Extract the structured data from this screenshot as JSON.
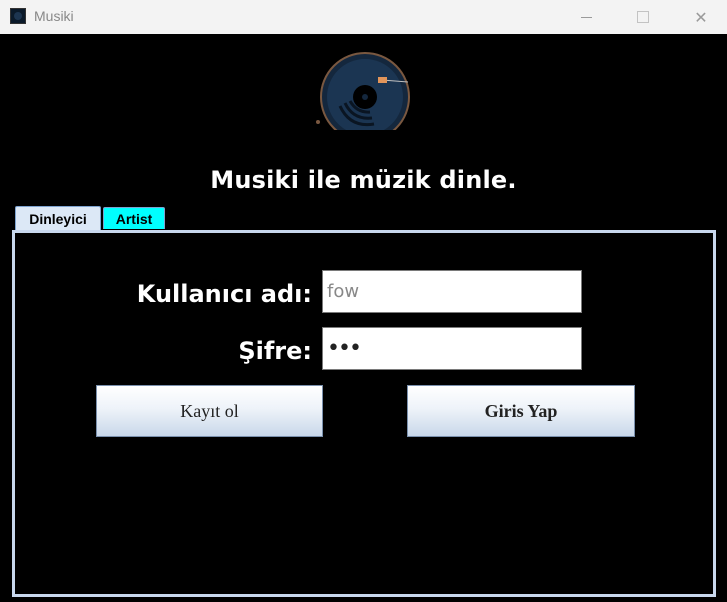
{
  "window": {
    "title": "Musiki",
    "controls": {
      "minimize_icon": "minimize-icon",
      "maximize_icon": "maximize-icon",
      "close_glyph": "✕"
    }
  },
  "header": {
    "logo_icon": "vinyl-record-icon",
    "tagline": "Musiki ile müzik dinle."
  },
  "tabs": [
    {
      "label": "Dinleyici",
      "selected": true,
      "color": "#dce8f6"
    },
    {
      "label": "Artist",
      "selected": false,
      "color": "#00ffff"
    }
  ],
  "form": {
    "username_label": "Kullanıcı adı:",
    "username_value": "fow",
    "password_label": "Şifre:",
    "password_masked": "•••"
  },
  "buttons": {
    "register_label": "Kayıt ol",
    "login_label": "Giris Yap"
  },
  "colors": {
    "background": "#000000",
    "panel_border": "#c8d8ee",
    "artist_tab": "#00ffff"
  }
}
